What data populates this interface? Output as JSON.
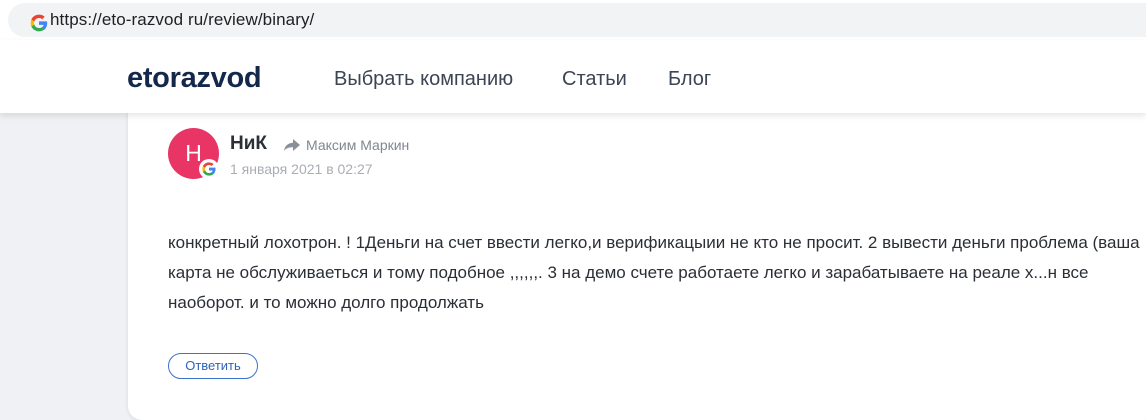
{
  "browser": {
    "url": "https://eto-razvod ru/review/binary/"
  },
  "site": {
    "logo": "etorazvod",
    "nav": [
      "Выбрать компанию",
      "Статьи",
      "Блог"
    ]
  },
  "comment": {
    "avatar_letter": "Н",
    "avatar_color": "#e83565",
    "author": "НиК",
    "reply_to": "Максим Маркин",
    "date": "1 января 2021 в 02:27",
    "text": "конкретный лохотрон. ! 1Деньги на счет ввести легко,и верификацыии не кто не просит. 2 вывести деньги проблема (ваша карта не обслуживаеться и тому подобное ,,,,,,. 3 на демо счете работаете легко и зарабатываете на реале х...н все наоборот. и то можно долго продолжать",
    "reply_button": "Ответить"
  },
  "icons": {
    "browser_site_icon": "google-g-icon",
    "avatar_badge": "google-g-icon",
    "reply_indicator": "reply-arrow-icon"
  }
}
